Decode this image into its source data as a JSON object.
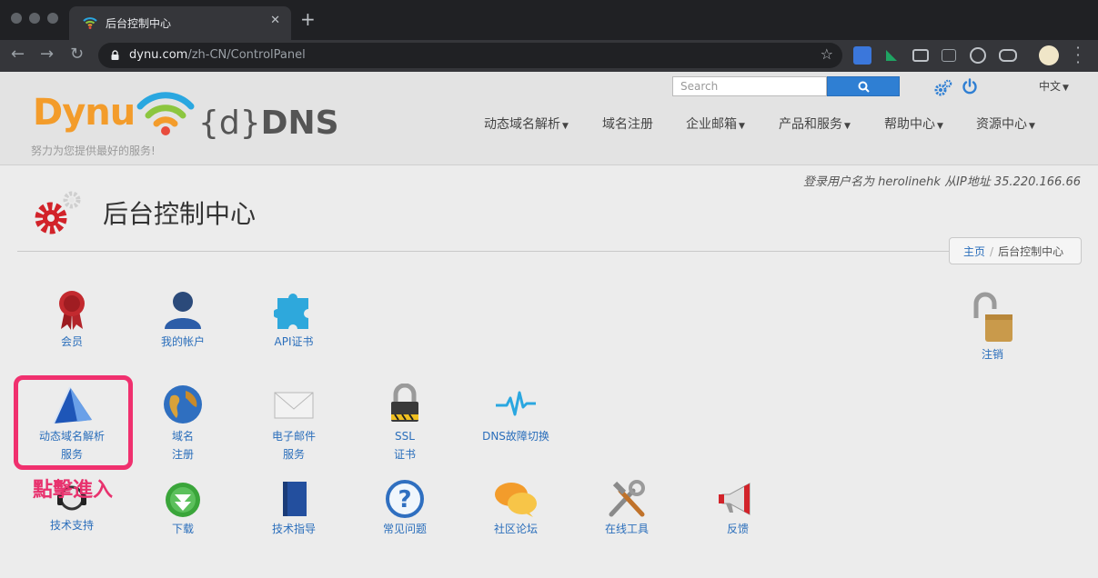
{
  "browser": {
    "tab_title": "后台控制中心",
    "tab_close": "✕",
    "new_tab": "+",
    "url_host": "dynu.com",
    "url_path": "/zh-CN/ControlPanel",
    "back": "←",
    "forward": "→",
    "reload": "↻",
    "star": "☆"
  },
  "header": {
    "logo_text": "Dynu",
    "ddns_prefix": "{d}",
    "ddns_suffix": "DNS",
    "tagline": "努力为您提供最好的服务!",
    "search_placeholder": "Search",
    "language": "中文",
    "menu": [
      "动态域名解析",
      "域名注册",
      "企业邮箱",
      "产品和服务",
      "帮助中心",
      "资源中心"
    ]
  },
  "page": {
    "login_info": "登录用户名为 herolinehk 从IP地址 35.220.166.66",
    "title": "后台控制中心",
    "breadcrumb": {
      "home": "主页",
      "separator": "/",
      "current": "后台控制中心"
    }
  },
  "tiles": {
    "member": "会员",
    "account": "我的帐户",
    "api": "API证书",
    "logout": "注销",
    "ddns_1": "动态域名解析",
    "ddns_2": "服务",
    "domain_1": "域名",
    "domain_2": "注册",
    "email_1": "电子邮件",
    "email_2": "服务",
    "ssl_1": "SSL",
    "ssl_2": "证书",
    "failover": "DNS故障切换",
    "support": "技术支持",
    "download": "下载",
    "guide": "技术指导",
    "faq": "常见问题",
    "forum": "社区论坛",
    "tools": "在线工具",
    "feedback": "反馈"
  },
  "annotation": "點擊進入",
  "colors": {
    "link": "#2a6ebb",
    "accent_orange": "#f39c2b",
    "highlight": "#f0306e",
    "search_button": "#2f7fd3"
  }
}
